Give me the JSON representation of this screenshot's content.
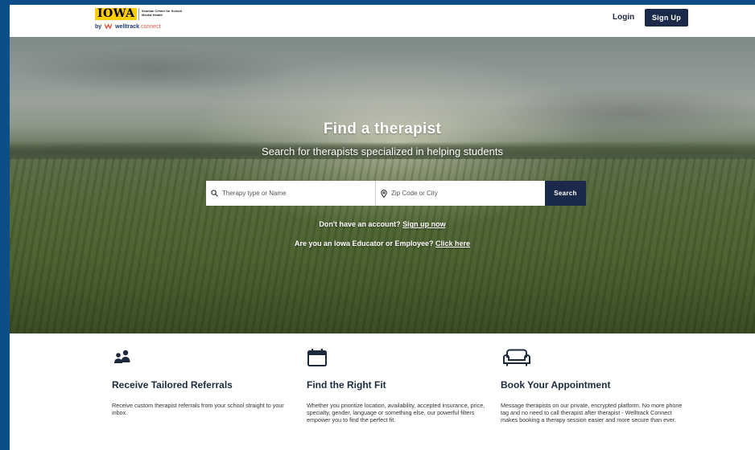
{
  "header": {
    "logo": {
      "iowa": "IOWA",
      "center_name": "Scanlan Center for School Mental Health",
      "by_prefix": "by",
      "welltrack": "welltrack",
      "connect": "connect"
    },
    "login_label": "Login",
    "signup_label": "Sign Up"
  },
  "hero": {
    "title": "Find a therapist",
    "subtitle": "Search for therapists specialized in helping students",
    "search": {
      "therapy_placeholder": "Therapy type or Name",
      "zip_placeholder": "Zip Code or City",
      "button_label": "Search"
    },
    "account_prompt": "Don't have an account?",
    "account_link": "Sign up now",
    "educator_prompt": "Are you an Iowa Educator or Employee?",
    "educator_link": "Click here"
  },
  "features": [
    {
      "icon": "users-icon",
      "title": "Receive Tailored Referrals",
      "text": "Receive custom therapist referrals from your school straight to your inbox."
    },
    {
      "icon": "calendar-icon",
      "title": "Find the Right Fit",
      "text": "Whether you prioritize location, availability, accepted insurance, price, specialty, gender, language or something else, our powerful filters empower you to find the perfect fit."
    },
    {
      "icon": "sofa-icon",
      "title": "Book Your Appointment",
      "text": "Message therapists on our private, encrypted platform. No more phone tag and no need to call therapist after therapist - Welltrack Connect makes booking a therapy session easier and more secure than ever."
    }
  ],
  "colors": {
    "frame": "#0c4e8a",
    "navy_button": "#1b2a4a",
    "iowa_gold": "#ffcd00",
    "brand_orange": "#e9573f"
  }
}
